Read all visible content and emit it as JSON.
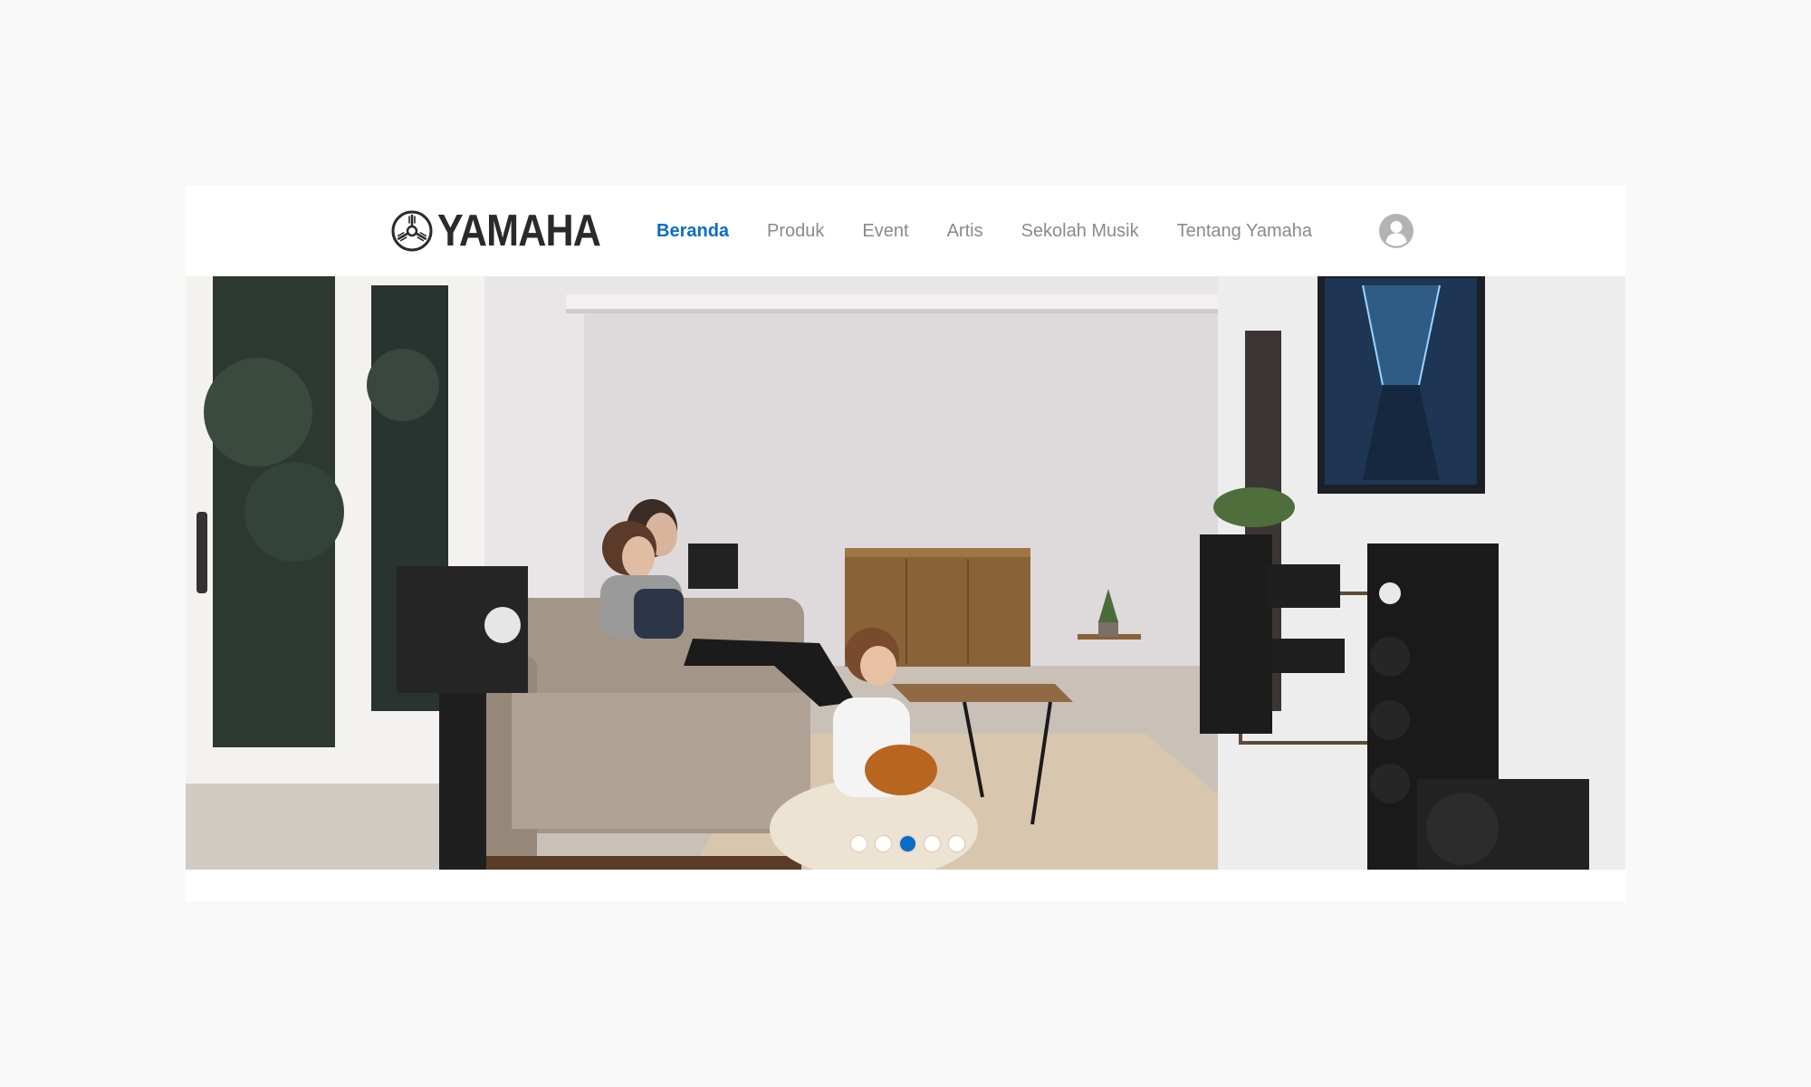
{
  "brand": {
    "name": "YAMAHA",
    "logo_icon": "tuning-fork-emblem-icon"
  },
  "nav": {
    "items": [
      {
        "label": "Beranda",
        "active": true
      },
      {
        "label": "Produk",
        "active": false
      },
      {
        "label": "Event",
        "active": false
      },
      {
        "label": "Artis",
        "active": false
      },
      {
        "label": "Sekolah Musik",
        "active": false
      },
      {
        "label": "Tentang Yamaha",
        "active": false
      }
    ],
    "user_icon": "user-avatar-icon"
  },
  "hero": {
    "image": "family-home-theater-living-room-photo",
    "slides_count": 5,
    "active_slide": 3
  },
  "colors": {
    "accent": "#0a6cc7",
    "nav_text": "#8a8a8a",
    "page_bg": "#f9f9f9",
    "logo": "#2a2a2a"
  }
}
